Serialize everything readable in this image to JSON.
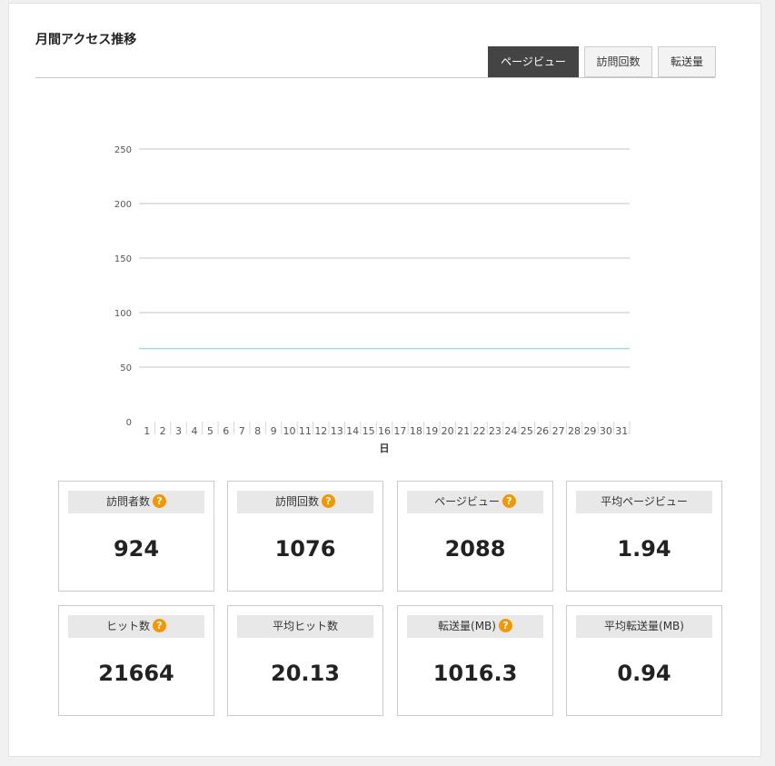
{
  "panel": {
    "title": "月間アクセス推移",
    "tabs": [
      {
        "label": "ページビュー",
        "active": true
      },
      {
        "label": "訪問回数",
        "active": false
      },
      {
        "label": "転送量",
        "active": false
      }
    ]
  },
  "chart_data": {
    "type": "line",
    "xlabel": "日",
    "ylabel": "",
    "ylim": [
      0,
      250
    ],
    "yticks": [
      0,
      50,
      100,
      150,
      200,
      250
    ],
    "categories": [
      "1",
      "2",
      "3",
      "4",
      "5",
      "6",
      "7",
      "8",
      "9",
      "10",
      "11",
      "12",
      "13",
      "14",
      "15",
      "16",
      "17",
      "18",
      "19",
      "20",
      "21",
      "22",
      "23",
      "24",
      "25",
      "26",
      "27",
      "28",
      "29",
      "30",
      "31"
    ],
    "series": [
      {
        "values": [
          67,
          67,
          67,
          67,
          67,
          67,
          67,
          67,
          67,
          67,
          67,
          67,
          67,
          67,
          67,
          67,
          67,
          67,
          67,
          67,
          67,
          67,
          67,
          67,
          67,
          67,
          67,
          67,
          67,
          67,
          67
        ],
        "color": "#a8d8e0"
      }
    ],
    "grid": true
  },
  "stats": [
    {
      "label": "訪問者数",
      "value": "924",
      "help": "?"
    },
    {
      "label": "訪問回数",
      "value": "1076",
      "help": "?"
    },
    {
      "label": "ページビュー",
      "value": "2088",
      "help": "?"
    },
    {
      "label": "平均ページビュー",
      "value": "1.94"
    },
    {
      "label": "ヒット数",
      "value": "21664",
      "help": "?"
    },
    {
      "label": "平均ヒット数",
      "value": "20.13"
    },
    {
      "label": "転送量(MB)",
      "value": "1016.3",
      "help": "?"
    },
    {
      "label": "平均転送量(MB)",
      "value": "0.94"
    }
  ],
  "colors": {
    "help_icon": "#f39800",
    "active_tab": "#444444",
    "line": "#a8d8e0"
  }
}
